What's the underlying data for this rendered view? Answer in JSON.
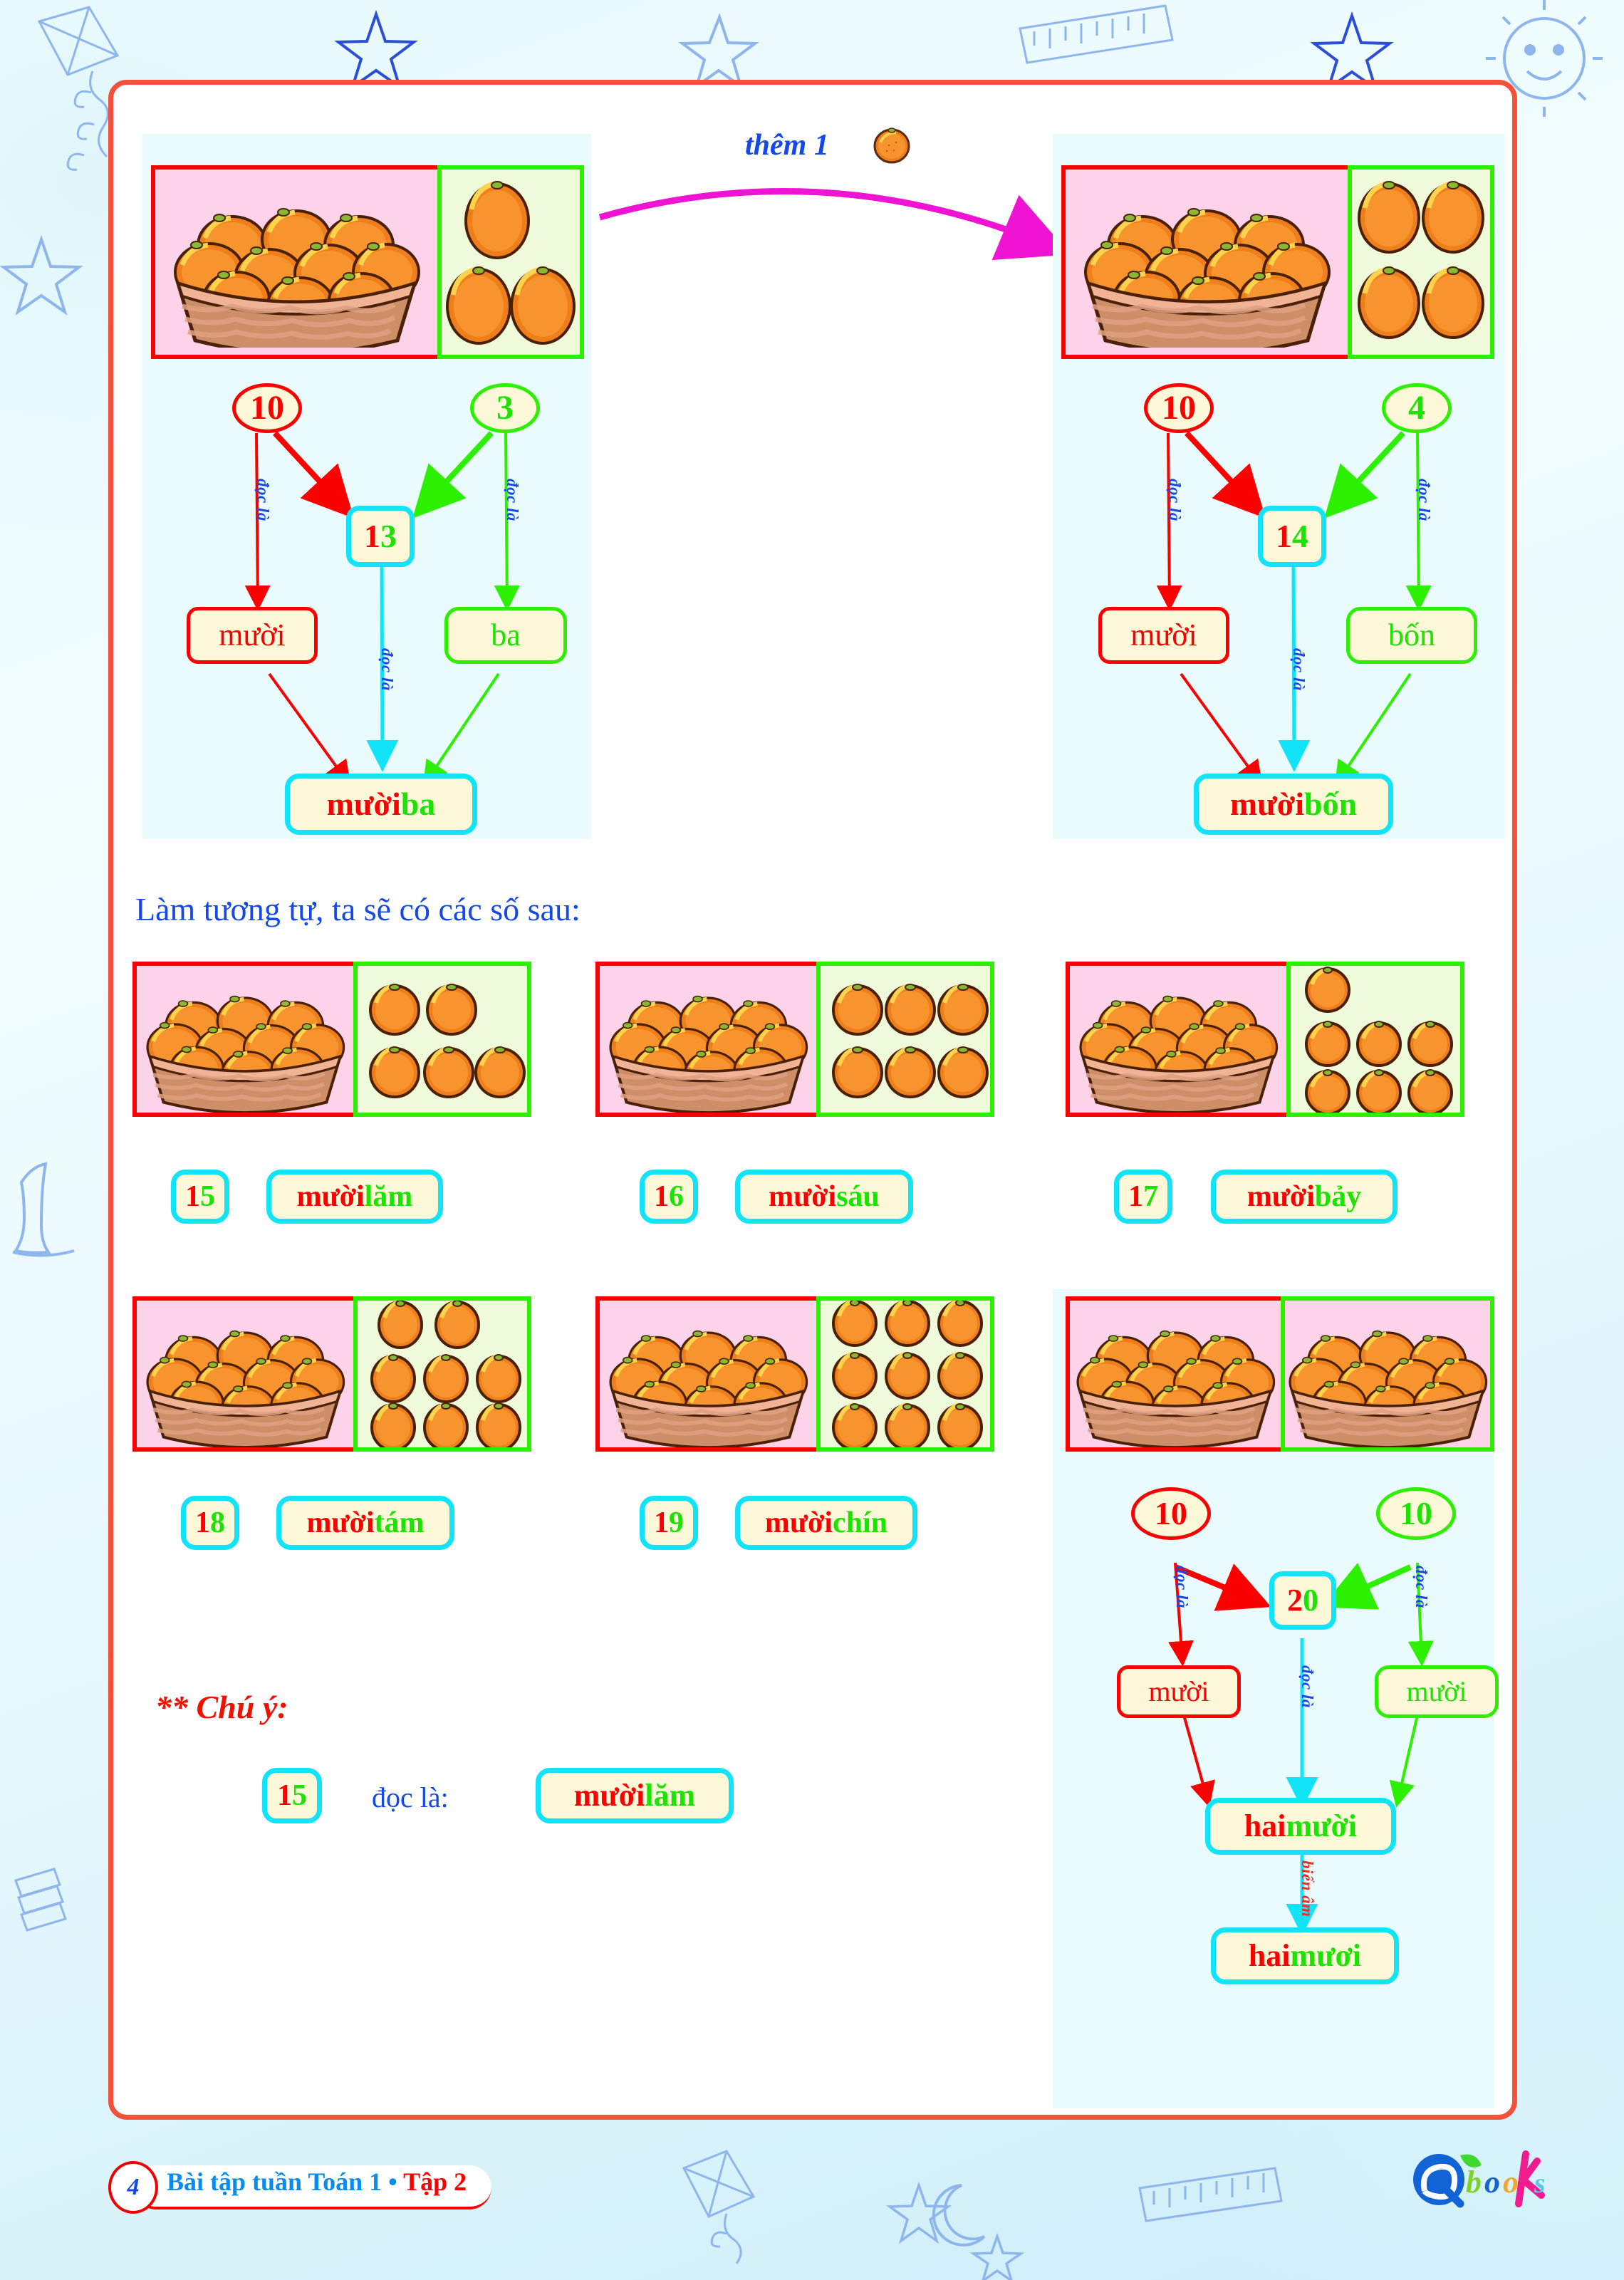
{
  "page": {
    "footer_number": "4",
    "footer_title_blue": "Bài tập tuần Toán 1 ",
    "footer_bullet": "•",
    "footer_title_red": " Tập 2",
    "logo": "Qbooks"
  },
  "top": {
    "them_label": "thêm 1",
    "left_diagram": {
      "basket_count": 10,
      "loose_count": 3,
      "left_oval": "10",
      "right_oval": "3",
      "sum_box_red": "1",
      "sum_box_green": "3",
      "left_word": "mười",
      "right_word": "ba",
      "result_word_red": "mười ",
      "result_word_green": "ba",
      "arrow_label": "đọc là"
    },
    "right_diagram": {
      "basket_count": 10,
      "loose_count": 4,
      "left_oval": "10",
      "right_oval": "4",
      "sum_box_red": "1",
      "sum_box_green": "4",
      "left_word": "mười",
      "right_word": "bốn",
      "result_word_red": "mười ",
      "result_word_green": "bốn",
      "arrow_label": "đọc là"
    }
  },
  "middle": {
    "intro": "Làm tương tự, ta sẽ có các số sau:",
    "cards": [
      {
        "num_red": "1",
        "num_green": "5",
        "word_red": "mười ",
        "word_green": "lăm",
        "loose": 5
      },
      {
        "num_red": "1",
        "num_green": "6",
        "word_red": "mười ",
        "word_green": "sáu",
        "loose": 6
      },
      {
        "num_red": "1",
        "num_green": "7",
        "word_red": "mười ",
        "word_green": "bảy",
        "loose": 7
      },
      {
        "num_red": "1",
        "num_green": "8",
        "word_red": "mười ",
        "word_green": "tám",
        "loose": 8
      },
      {
        "num_red": "1",
        "num_green": "9",
        "word_red": "mười ",
        "word_green": "chín",
        "loose": 9
      }
    ]
  },
  "note": {
    "heading": "** Chú ý:",
    "num_red": "1",
    "num_green": "5",
    "read_label": "đọc là:",
    "word_red": "mười ",
    "word_green": "lăm"
  },
  "twenty": {
    "left_oval": "10",
    "right_oval": "10",
    "sum_red": "2",
    "sum_green": "0",
    "left_word": "mười",
    "right_word": "mười",
    "result_red": "hai ",
    "result_green": "mười",
    "final_red": "hai ",
    "final_green": "mươi",
    "arrow_label": "đọc là",
    "transform_label": "biến âm"
  },
  "colors": {
    "red": "#fb0000",
    "green": "#1ae400",
    "blue": "#1449e8",
    "cyan": "#12e4f7",
    "magenta": "#ef14d4",
    "frame": "#f4503b",
    "box_pink": "#fdd3ea",
    "box_green": "#eefad9",
    "node_fill": "#fdf8d8"
  }
}
